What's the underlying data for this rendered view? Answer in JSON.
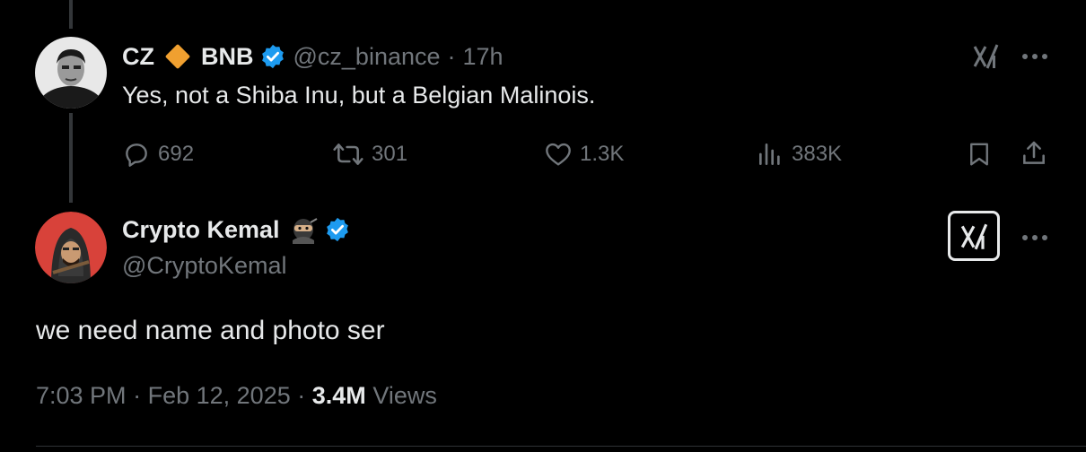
{
  "parent_tweet": {
    "display_name_part1": "CZ",
    "display_name_part2": "BNB",
    "handle": "@cz_binance",
    "separator": "·",
    "time_ago": "17h",
    "text": "Yes, not a Shiba Inu, but a Belgian Malinois.",
    "actions": {
      "replies": "692",
      "reposts": "301",
      "likes": "1.3K",
      "views": "383K"
    }
  },
  "main_tweet": {
    "display_name": "Crypto Kemal",
    "handle": "@CryptoKemal",
    "text": "we need name and photo ser",
    "time": "7:03 PM",
    "date": "Feb 12, 2025",
    "views_count": "3.4M",
    "views_label": "Views",
    "separator": "·"
  },
  "colors": {
    "background": "#000000",
    "text_primary": "#e7e9ea",
    "text_secondary": "#71767b",
    "verified_blue": "#1d9bf0",
    "bnb_orange": "#f0a030",
    "avatar_red": "#d8423a"
  },
  "icons": [
    "reply-icon",
    "repost-icon",
    "like-icon",
    "views-icon",
    "bookmark-icon",
    "share-icon",
    "grok-icon",
    "more-icon",
    "verified-badge-icon",
    "ninja-emoji-icon",
    "diamond-icon"
  ]
}
